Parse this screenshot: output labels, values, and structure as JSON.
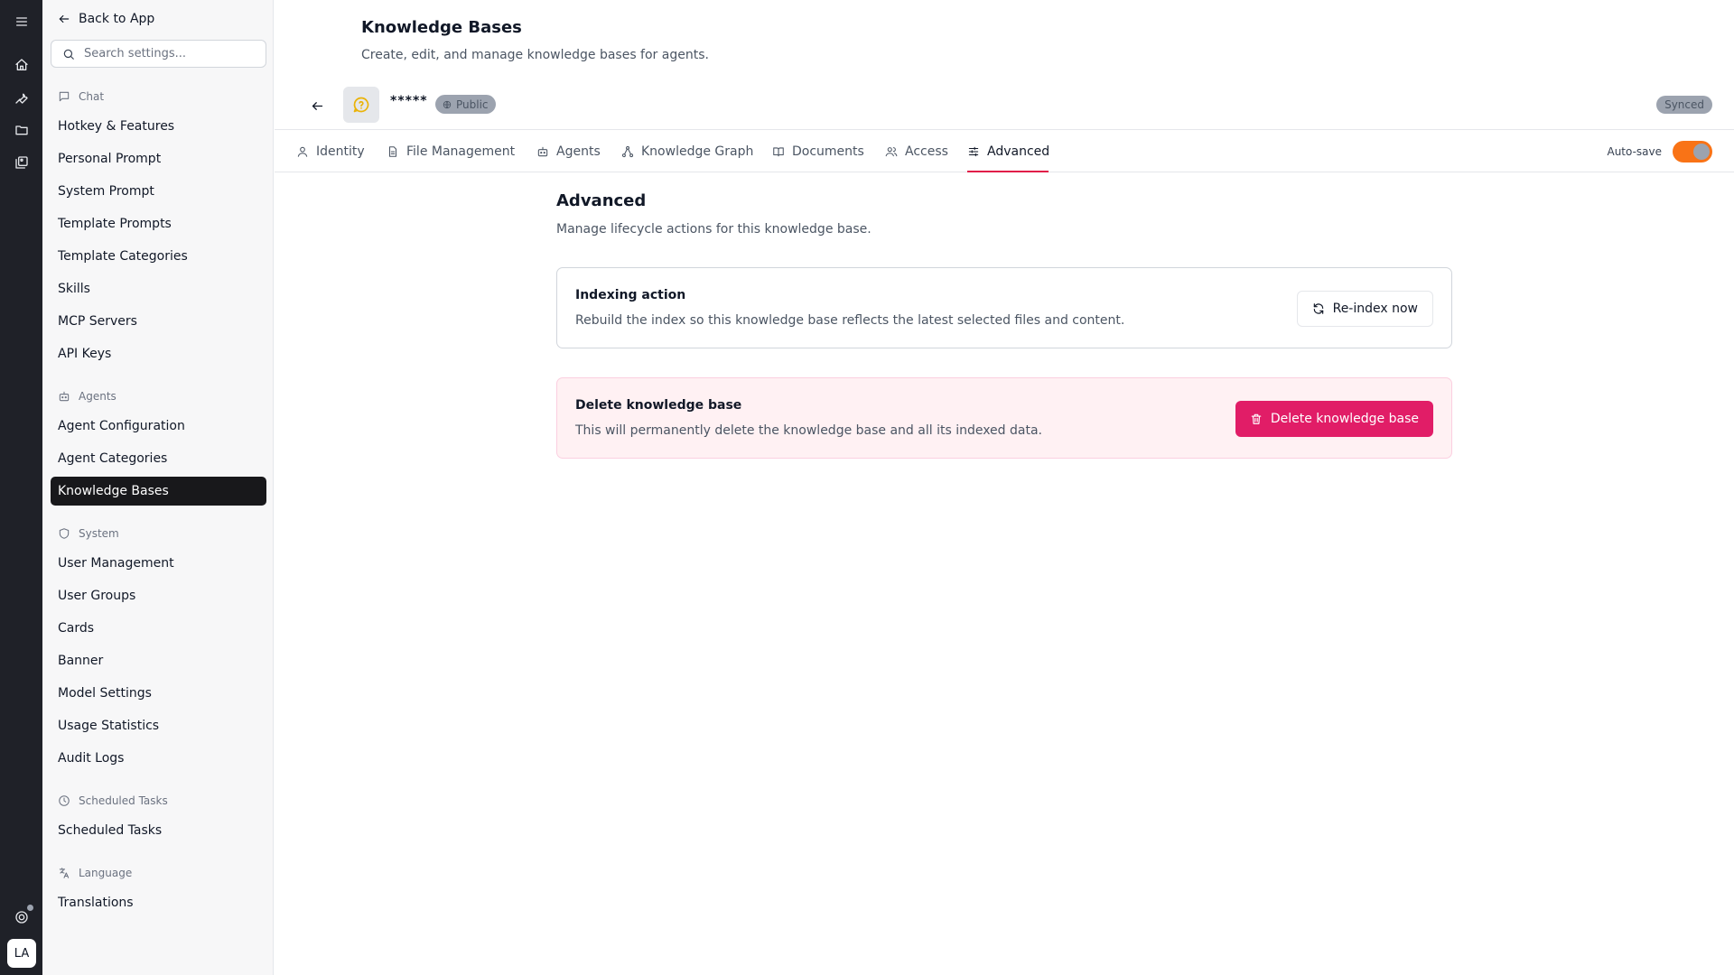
{
  "rail": {
    "icons": [
      "menu-icon",
      "home-icon",
      "wrench-icon",
      "folder-icon",
      "gallery-icon",
      "support-icon"
    ],
    "avatar_initials": "LA"
  },
  "sidebar": {
    "back_label": "Back to App",
    "search_placeholder": "Search settings...",
    "sections": [
      {
        "title": "Chat",
        "items": [
          "Hotkey & Features",
          "Personal Prompt",
          "System Prompt",
          "Template Prompts",
          "Template Categories",
          "Skills",
          "MCP Servers",
          "API Keys"
        ]
      },
      {
        "title": "Agents",
        "items": [
          "Agent Configuration",
          "Agent Categories",
          "Knowledge Bases"
        ]
      },
      {
        "title": "System",
        "items": [
          "User Management",
          "User Groups",
          "Cards",
          "Banner",
          "Model Settings",
          "Usage Statistics",
          "Audit Logs"
        ]
      },
      {
        "title": "Scheduled Tasks",
        "items": [
          "Scheduled Tasks"
        ]
      },
      {
        "title": "Language",
        "items": [
          "Translations"
        ]
      }
    ],
    "active_item": "Knowledge Bases"
  },
  "header": {
    "title": "Knowledge Bases",
    "subtitle": "Create, edit, and manage knowledge bases for agents."
  },
  "kb": {
    "name": "*****",
    "visibility": "Public",
    "sync_status": "Synced"
  },
  "tabs": {
    "items": [
      "Identity",
      "File Management",
      "Agents",
      "Knowledge Graph",
      "Documents",
      "Access",
      "Advanced"
    ],
    "active": "Advanced",
    "autosave_label": "Auto-save",
    "autosave_on": true
  },
  "content": {
    "title": "Advanced",
    "subtitle": "Manage lifecycle actions for this knowledge base.",
    "indexing": {
      "title": "Indexing action",
      "description": "Rebuild the index so this knowledge base reflects the latest selected files and content.",
      "button": "Re-index now"
    },
    "delete": {
      "title": "Delete knowledge base",
      "description": "This will permanently delete the knowledge base and all its indexed data.",
      "button": "Delete knowledge base"
    }
  },
  "colors": {
    "rail_bg": "#1f2128",
    "active_nav_bg": "#18181b",
    "accent_underline": "#e11d48",
    "toggle_on": "#f97316",
    "danger_button": "#e11d67",
    "danger_card_bg": "#fff1f3"
  }
}
